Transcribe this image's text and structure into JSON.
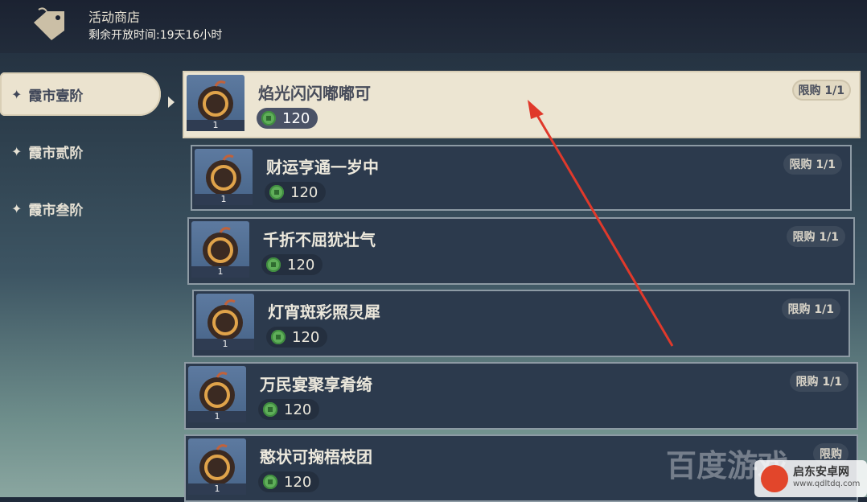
{
  "header": {
    "title": "活动商店",
    "remaining": "剩余开放时间:19天16小时"
  },
  "sidebar": {
    "items": [
      {
        "label": "霞市壹阶",
        "active": true
      },
      {
        "label": "霞市贰阶",
        "active": false
      },
      {
        "label": "霞市叁阶",
        "active": false
      }
    ]
  },
  "items": [
    {
      "name": "焰光闪闪嘟嘟可",
      "price": "120",
      "limit": "限购 1/1",
      "qty": "1",
      "selected": true
    },
    {
      "name": "财运亨通一岁中",
      "price": "120",
      "limit": "限购 1/1",
      "qty": "1"
    },
    {
      "name": "千折不屈犹壮气",
      "price": "120",
      "limit": "限购 1/1",
      "qty": "1"
    },
    {
      "name": "灯宵斑彩照灵犀",
      "price": "120",
      "limit": "限购 1/1",
      "qty": "1"
    },
    {
      "name": "万民宴聚享肴绮",
      "price": "120",
      "limit": "限购 1/1",
      "qty": "1"
    },
    {
      "name": "憨状可掬梧枝团",
      "price": "120",
      "limit": "限购",
      "qty": "1"
    }
  ],
  "watermark": {
    "text": "百度游戏",
    "site": "启东安卓网",
    "url": "www.qdltdq.com"
  },
  "colors": {
    "selected_bg": "#ece5d2",
    "row_bg": "#2c3a4d",
    "arrow": "#e0392b",
    "coin": "#5fae59"
  }
}
